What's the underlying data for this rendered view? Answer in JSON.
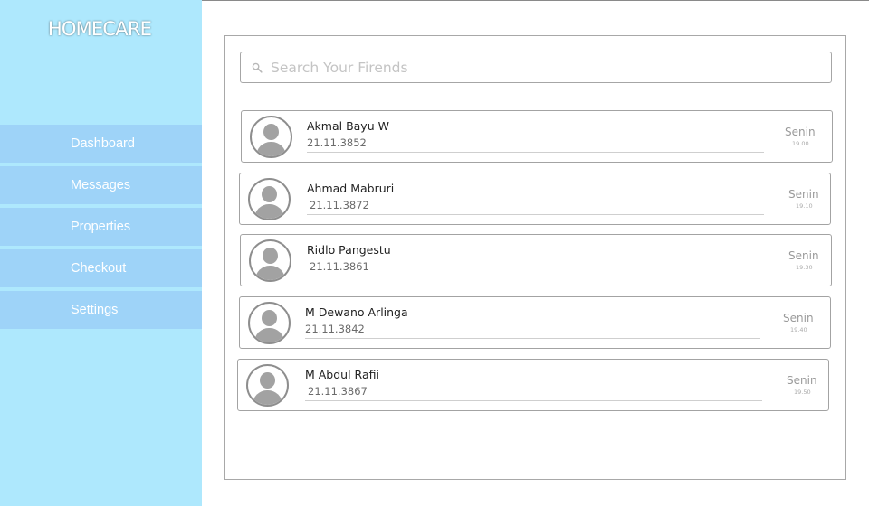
{
  "brand": "HOMECARE",
  "nav": [
    "Dashboard",
    "Messages",
    "Properties",
    "Checkout",
    "Settings"
  ],
  "search": {
    "placeholder": "Search Your Firends"
  },
  "friends": [
    {
      "name": "Akmal Bayu W",
      "id": "21.11.3852",
      "day": "Senin",
      "time": "19.00"
    },
    {
      "name": "Ahmad Mabruri",
      "id": "21.11.3872",
      "day": "Senin",
      "time": "19.10"
    },
    {
      "name": "Ridlo Pangestu",
      "id": "21.11.3861",
      "day": "Senin",
      "time": "19.30"
    },
    {
      "name": "M Dewano Arlinga",
      "id": "21.11.3842",
      "day": "Senin",
      "time": "19.40"
    },
    {
      "name": "M Abdul Rafii",
      "id": "21.11.3867",
      "day": "Senin",
      "time": "19.50"
    }
  ],
  "colors": {
    "sidebar": "#aee8fd",
    "nav_item": "#9ed3f8",
    "avatar": "#a2a2a2"
  },
  "icons": {
    "search": "search-icon",
    "avatar": "avatar-icon"
  }
}
